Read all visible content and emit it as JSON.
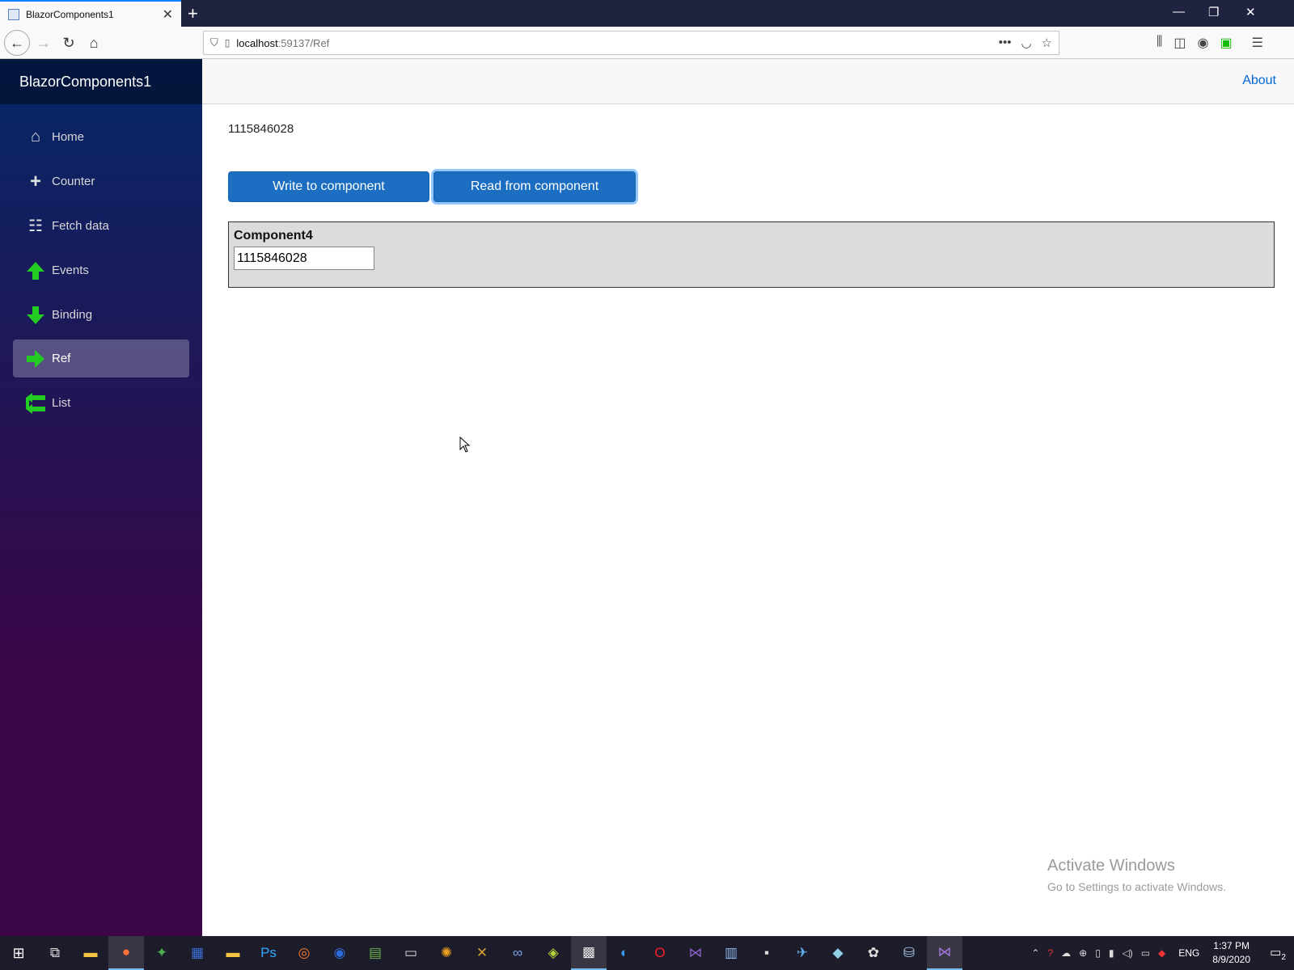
{
  "browser": {
    "tab_title": "BlazorComponents1",
    "url_host": "localhost",
    "url_path": ":59137/Ref"
  },
  "sidebar": {
    "brand": "BlazorComponents1",
    "items": [
      {
        "label": "Home",
        "icon": "home-icon"
      },
      {
        "label": "Counter",
        "icon": "plus-icon"
      },
      {
        "label": "Fetch data",
        "icon": "list-icon"
      },
      {
        "label": "Events",
        "icon": "arrow-up-icon"
      },
      {
        "label": "Binding",
        "icon": "arrow-down-icon"
      },
      {
        "label": "Ref",
        "icon": "arrow-right-icon",
        "active": true
      },
      {
        "label": "List",
        "icon": "arrows-left-icon"
      }
    ]
  },
  "topbar": {
    "about": "About"
  },
  "main": {
    "ref_value": "1115846028",
    "write_button": "Write to component",
    "read_button": "Read from component",
    "component": {
      "title": "Component4",
      "input_value": "1115846028"
    }
  },
  "watermark": {
    "line1": "Activate Windows",
    "line2": "Go to Settings to activate Windows."
  },
  "taskbar": {
    "lang": "ENG",
    "time": "1:37 PM",
    "date": "8/9/2020",
    "notifications": "2"
  },
  "colors": {
    "accent": "#1b6ec2",
    "sidebar_top": "#052767",
    "sidebar_bottom": "#3a0647",
    "link": "#0366d6",
    "icon_green": "#22cc22"
  }
}
